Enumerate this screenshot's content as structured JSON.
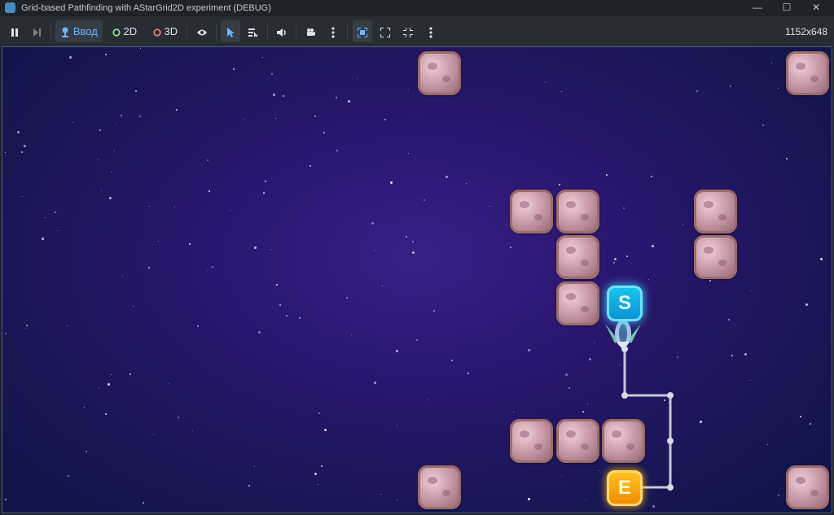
{
  "window": {
    "title": "Grid-based Pathfinding with AStarGrid2D experiment (DEBUG)",
    "controls": [
      "minimize",
      "maximize",
      "close"
    ]
  },
  "toolbar": {
    "input_label": "Ввод",
    "mode_2d_label": "2D",
    "mode_3d_label": "3D",
    "resolution": "1152x648"
  },
  "game": {
    "start_label": "S",
    "end_label": "E",
    "colors": {
      "start": "#16b4ea",
      "end": "#ffaa00",
      "path": "#c9c9d8"
    }
  }
}
